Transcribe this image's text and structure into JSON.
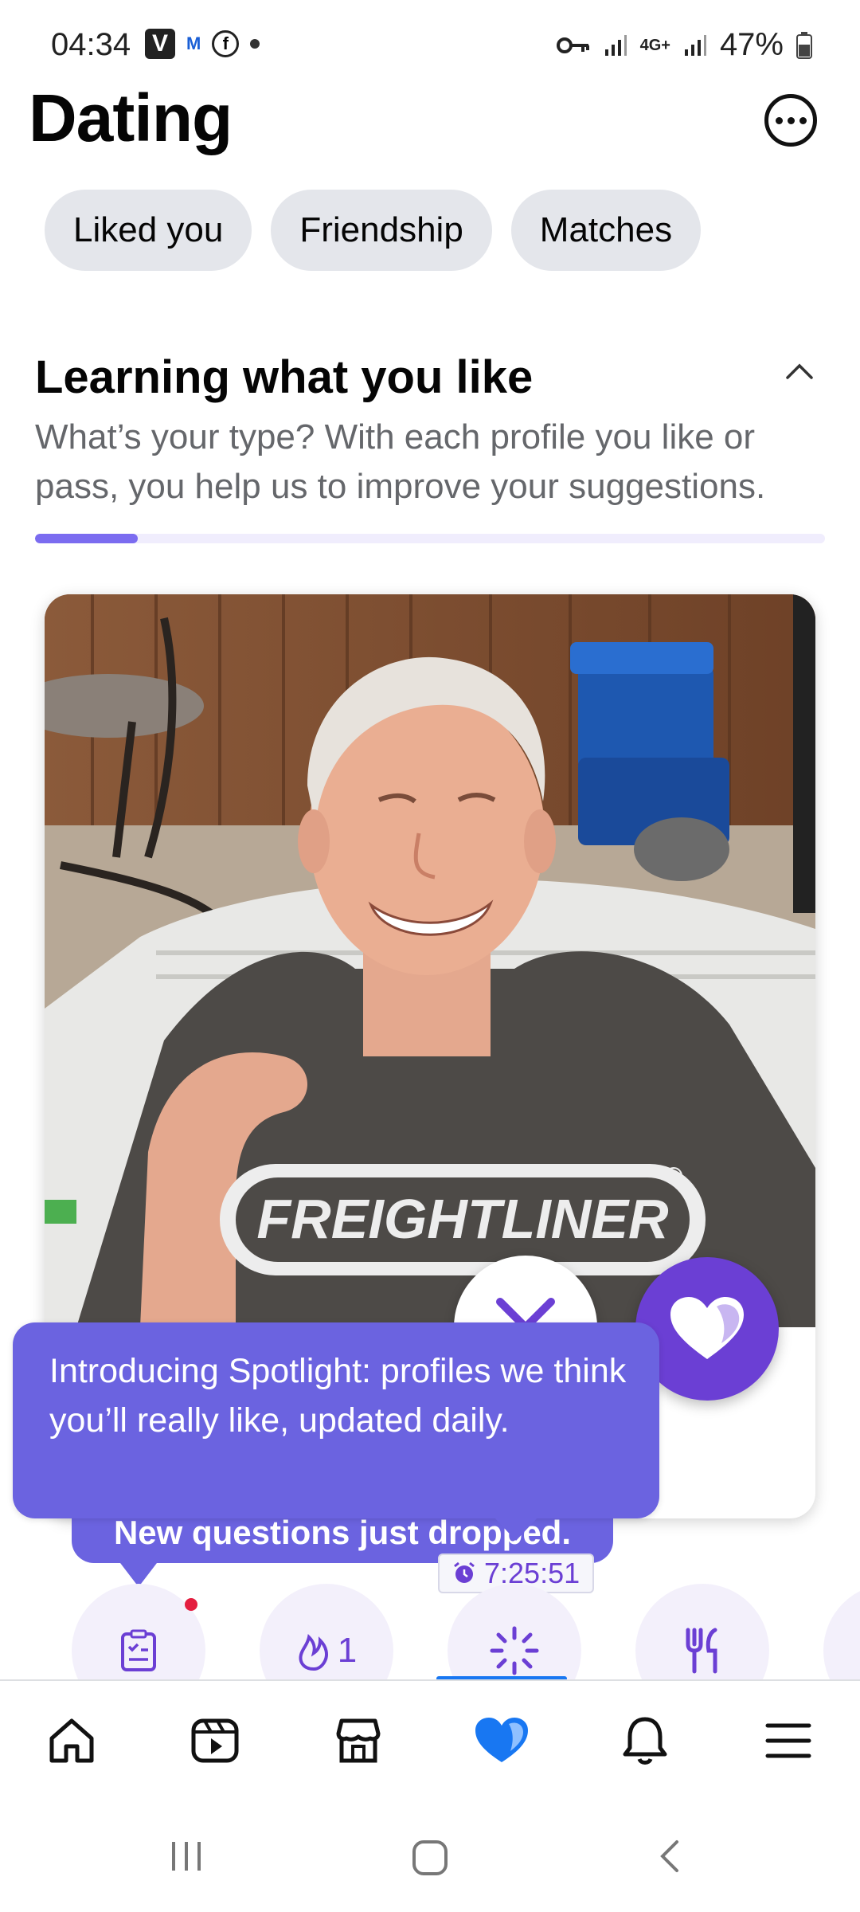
{
  "status_bar": {
    "time": "04:34",
    "battery": "47%",
    "network": "4G+"
  },
  "header": {
    "title": "Dating",
    "more_icon": "more-circle-icon"
  },
  "chips": [
    "Liked you",
    "Friendship",
    "Matches"
  ],
  "learning": {
    "title": "Learning what you like",
    "description": "What’s your type? With each profile you like or pass, you help us to improve your suggestions.",
    "progress": 0.13
  },
  "profile": {
    "shirt_text": "FREIGHTLINER"
  },
  "tooltips": {
    "spotlight": "Introducing Spotlight: profiles we think you’ll really like, updated daily.",
    "questions": "New questions just dropped."
  },
  "timer": "7:25:51",
  "categories": [
    {
      "icon": "questions-icon"
    },
    {
      "icon": "flame-icon",
      "count": "1"
    },
    {
      "icon": "spotlight-icon"
    },
    {
      "icon": "food-icon"
    }
  ],
  "bottom_nav": [
    "home-icon",
    "video-icon",
    "marketplace-icon",
    "dating-icon",
    "notifications-icon",
    "menu-icon"
  ],
  "colors": {
    "accent": "#6b3fd4",
    "tooltip": "#6b63e0",
    "fb_blue": "#1877f2",
    "chip_bg": "#e4e6eb"
  }
}
